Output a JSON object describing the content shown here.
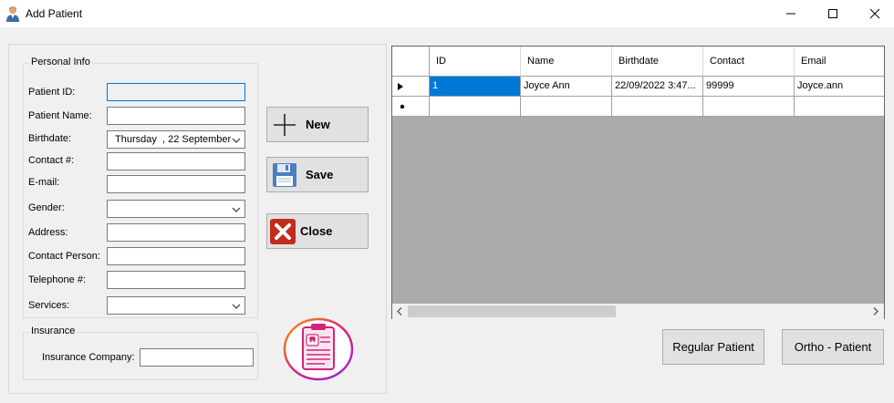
{
  "window": {
    "title": "Add Patient"
  },
  "personal_info": {
    "legend": "Personal Info",
    "patient_id_label": "Patient ID:",
    "patient_id_value": "",
    "patient_name_label": "Patient Name:",
    "patient_name_value": "",
    "birthdate_label": "Birthdate:",
    "birthdate_value": "Thursday  , 22 September",
    "contact_label": "Contact #:",
    "contact_value": "",
    "email_label": "E-mail:",
    "email_value": "",
    "gender_label": "Gender:",
    "gender_value": "",
    "address_label": "Address:",
    "address_value": "",
    "contact_person_label": "Contact Person:",
    "contact_person_value": "",
    "telephone_label": "Telephone #:",
    "telephone_value": "",
    "services_label": "Services:",
    "services_value": ""
  },
  "insurance": {
    "legend": "Insurance",
    "company_label": "Insurance Company:",
    "company_value": ""
  },
  "actions": {
    "new_label": "New",
    "save_label": "Save",
    "close_label": "Close"
  },
  "grid": {
    "columns": [
      "ID",
      "Name",
      "Birthdate",
      "Contact",
      "Email"
    ],
    "rows": [
      {
        "id": "1",
        "name": "Joyce Ann",
        "birthdate": "22/09/2022 3:47...",
        "contact": "99999",
        "email": "Joyce.ann"
      }
    ]
  },
  "filters": {
    "regular_label": "Regular Patient",
    "ortho_label": "Ortho - Patient"
  },
  "colors": {
    "selection": "#0078d7",
    "button_face": "#e1e1e1",
    "grid_background": "#ababab",
    "close_icon_red": "#c42b1c"
  },
  "icons": [
    "user-app-icon",
    "minimize-icon",
    "maximize-icon",
    "close-window-icon",
    "plus-icon",
    "floppy-disk-icon",
    "close-x-icon",
    "clipboard-dental-logo",
    "row-pointer-icon",
    "new-row-icon",
    "scroll-left-icon",
    "scroll-right-icon",
    "chevron-down-icon"
  ]
}
